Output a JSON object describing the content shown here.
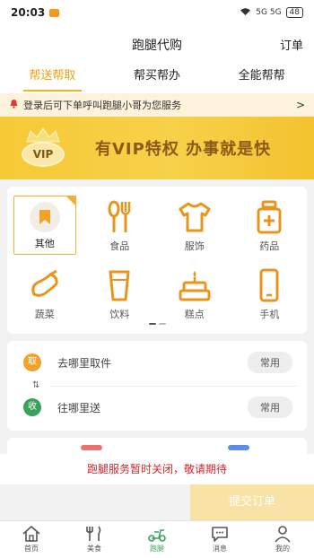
{
  "status_bar": {
    "time": "20:03",
    "signal_text": "5G 5G",
    "battery": "48"
  },
  "header": {
    "title": "跑腿代购",
    "order_label": "订单"
  },
  "tabs": [
    {
      "label": "帮送帮取",
      "active": true
    },
    {
      "label": "帮买帮办",
      "active": false
    },
    {
      "label": "全能帮帮",
      "active": false
    }
  ],
  "notice": {
    "text": "登录后可下单呼叫跑腿小哥为您服务",
    "arrow": ">",
    "icon": "bell-icon"
  },
  "banner": {
    "badge": "VIP",
    "slogan": "有VIP特权  办事就是快"
  },
  "services": [
    {
      "label": "其他",
      "icon": "bookmark-icon",
      "selected": true
    },
    {
      "label": "食品",
      "icon": "fork-spoon-icon"
    },
    {
      "label": "服饰",
      "icon": "shirt-icon"
    },
    {
      "label": "药品",
      "icon": "medicine-icon"
    },
    {
      "label": "蔬菜",
      "icon": "eggplant-icon"
    },
    {
      "label": "饮料",
      "icon": "cup-icon"
    },
    {
      "label": "糕点",
      "icon": "cake-icon"
    },
    {
      "label": "手机",
      "icon": "phone-icon"
    }
  ],
  "address": {
    "pickup": {
      "badge": "取",
      "text": "去哪里取件",
      "chip": "常用"
    },
    "deliver": {
      "badge": "收",
      "text": "往哪里送",
      "chip": "常用"
    },
    "swap_glyph": "⇅"
  },
  "closed_message": "跑腿服务暂时关闭，敬请期待",
  "submit_label": "提交订单",
  "bottom_nav": [
    {
      "label": "首页",
      "icon": "home-icon"
    },
    {
      "label": "美食",
      "icon": "food-icon"
    },
    {
      "label": "跑腿",
      "icon": "scooter-icon",
      "active": true
    },
    {
      "label": "消息",
      "icon": "message-icon"
    },
    {
      "label": "我的",
      "icon": "user-icon"
    }
  ],
  "colors": {
    "accent": "#f0b428",
    "active_nav": "#3aa35b",
    "alert": "#d2282c"
  }
}
